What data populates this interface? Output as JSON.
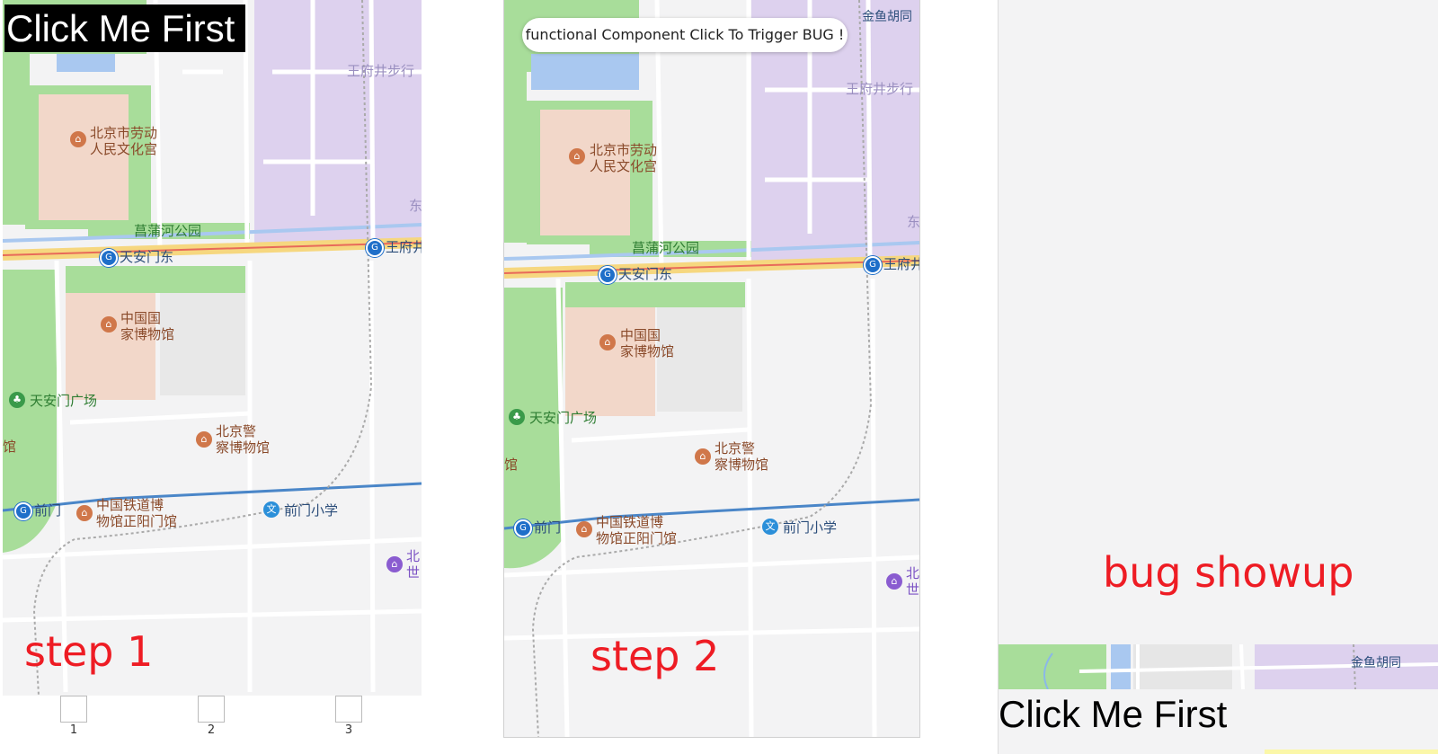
{
  "colors": {
    "accent_red": "#ee1c24",
    "water": "#a9c8f0",
    "park": "#a8dd9a",
    "landmark": "#f2d7c9",
    "district": "#ddd1ee",
    "road_major": "#f6d77f",
    "metro_line": "#4a86c8"
  },
  "map_labels": {
    "labor_palace": "北京市劳动\n人民文化宫",
    "changpu_park": "菖蒲河公园",
    "tiananmen_east": "天安门东",
    "wangfujing_station": "王府井",
    "museum_national": "中国国\n家博物馆",
    "tiananmen_square": "天安门广场",
    "police_museum": "北京警\n察博物馆",
    "qianmen": "前门",
    "railway_museum": "中国铁道博\n物馆正阳门馆",
    "qianmen_school": "前门小学",
    "wangfujing_walk": "王府井步行",
    "jinyu_hutong": "金鱼胡同",
    "east_fragment": "东",
    "guan_fragment": "馆",
    "bei_fragment": "北\n世"
  },
  "panel1": {
    "button_label": "Click Me First",
    "step_label": "step 1",
    "tabs": [
      {
        "label": "1"
      },
      {
        "label": "2"
      },
      {
        "label": "3"
      }
    ]
  },
  "panel2": {
    "banner_text": "functional Component Click To Trigger BUG !",
    "step_label": "step 2"
  },
  "panel3": {
    "bug_label": "bug showup",
    "button_label": "Click Me First",
    "strip_label": "金鱼胡同"
  }
}
